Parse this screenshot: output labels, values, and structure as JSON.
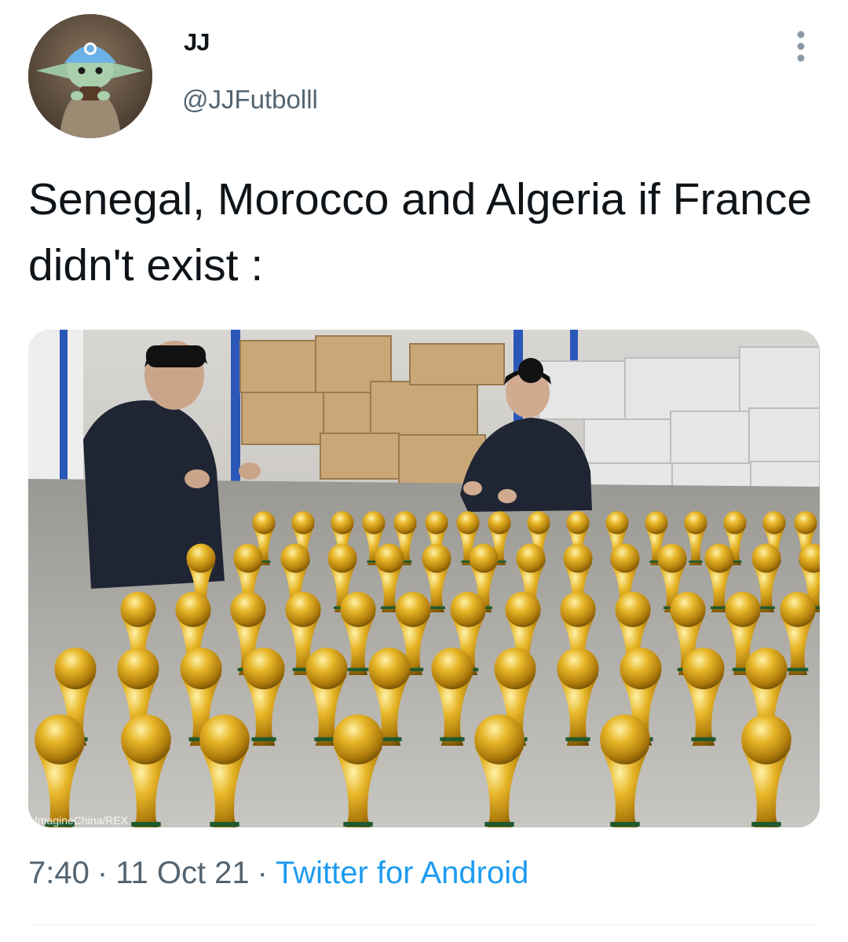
{
  "tweet": {
    "author": {
      "display_name": "JJ",
      "handle": "@JJFutbolll"
    },
    "text": "Senegal, Morocco and Algeria if France didn't exist :",
    "media": {
      "watermark": "ImagineChina/REX"
    },
    "meta": {
      "time": "7:40",
      "date": "11 Oct 21",
      "separator": "·",
      "source": "Twitter for Android"
    }
  },
  "colors": {
    "text_primary": "#0f1419",
    "text_secondary": "#536471",
    "link": "#1d9bf0",
    "divider": "#eff3f4",
    "trophy_gold": "#d8a21e"
  },
  "icons": {
    "more": "more-vertical-icon"
  }
}
